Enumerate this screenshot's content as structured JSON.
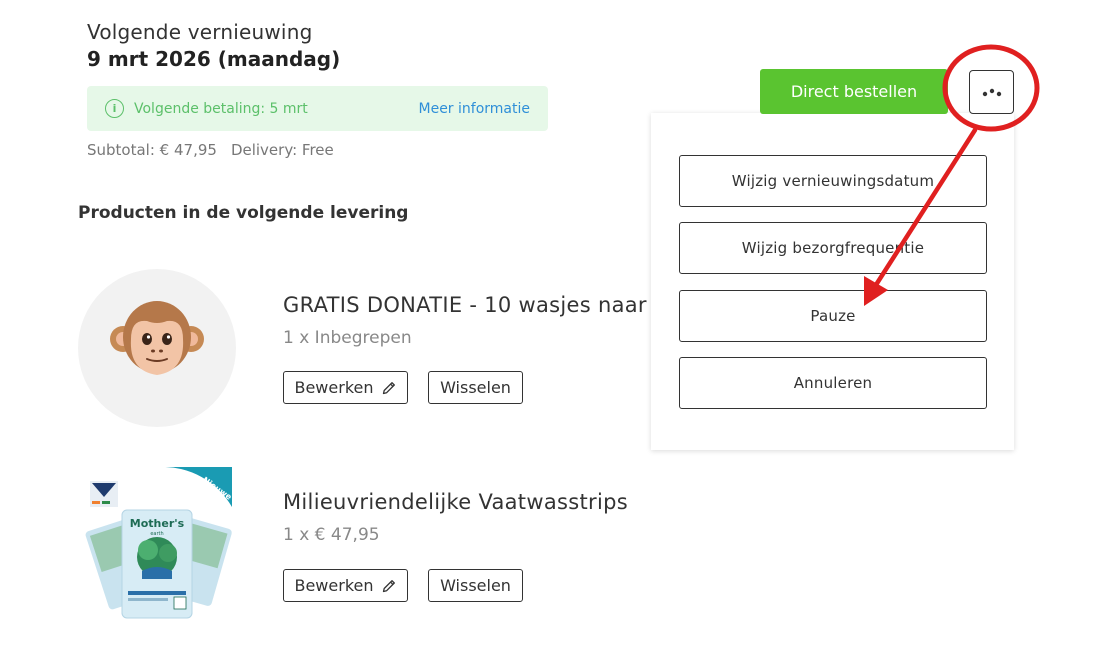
{
  "renewal": {
    "label": "Volgende vernieuwing",
    "date": "9 mrt 2026 (maandag)"
  },
  "payment_banner": {
    "icon": "info-icon",
    "text": "Volgende betaling: 5 mrt",
    "link": "Meer informatie"
  },
  "totals": {
    "subtotal": "Subtotal: € 47,95",
    "delivery": "Delivery: Free"
  },
  "section_title": "Producten in de volgende levering",
  "products": [
    {
      "name": "GRATIS DONATIE - 10 wasjes naar",
      "qty": "1 x Inbegrepen",
      "image": "monkey-emoji",
      "edit_label": "Bewerken",
      "swap_label": "Wisselen"
    },
    {
      "name": "Milieuvriendelijke Vaatwasstrips",
      "qty": "1 x € 47,95",
      "image": "product-package",
      "package_brand": "Mother's",
      "package_sub": "earth",
      "package_ribbon": "Nieuwe verpakking",
      "edit_label": "Bewerken",
      "swap_label": "Wisselen"
    }
  ],
  "actions": {
    "order_now": "Direct bestellen",
    "more_icon": "ellipsis-icon"
  },
  "dropdown": {
    "items": [
      "Wijzig vernieuwingsdatum",
      "Wijzig bezorgfrequentie",
      "Pauze",
      "Annuleren"
    ]
  },
  "colors": {
    "accent_green": "#5ac430",
    "banner_bg": "#e6f8e8",
    "banner_text": "#5cc06a",
    "link_blue": "#2f8fd8",
    "annotation_red": "#e02020"
  }
}
